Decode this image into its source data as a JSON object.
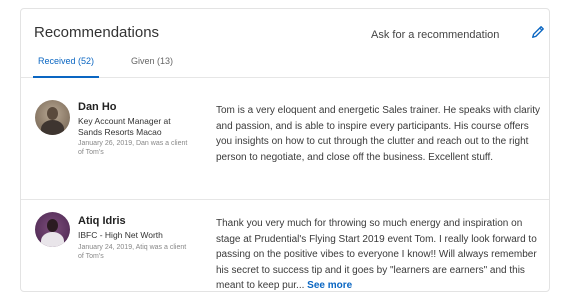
{
  "section": {
    "title": "Recommendations",
    "ask_label": "Ask for a recommendation",
    "edit_icon": "pencil-icon",
    "accent_color": "#0a66c2"
  },
  "tabs": [
    {
      "label": "Received (52)",
      "active": true
    },
    {
      "label": "Given (13)",
      "active": false
    }
  ],
  "recommendations": [
    {
      "name": "Dan Ho",
      "role": "Key Account Manager at Sands Resorts Macao",
      "meta": "January 26, 2019, Dan was a client of Tom's",
      "text": "Tom is a very eloquent and energetic Sales trainer. He speaks with clarity and passion, and is able to inspire every participants. His course offers you insights on how to cut through the clutter and reach out to the right person to negotiate, and close off the business. Excellent stuff.",
      "see_more": ""
    },
    {
      "name": "Atiq Idris",
      "role": "IBFC - High Net Worth",
      "meta": "January 24, 2019, Atiq was a client of Tom's",
      "text": "Thank you very much for throwing so much energy and inspiration on stage at Prudential's Flying Start 2019 event Tom. I really look forward to passing on the positive vibes to everyone I know!! Will always remember his secret to success tip and it goes by \"learners are earners\" and this meant to keep pur...",
      "see_more": "See more"
    }
  ]
}
